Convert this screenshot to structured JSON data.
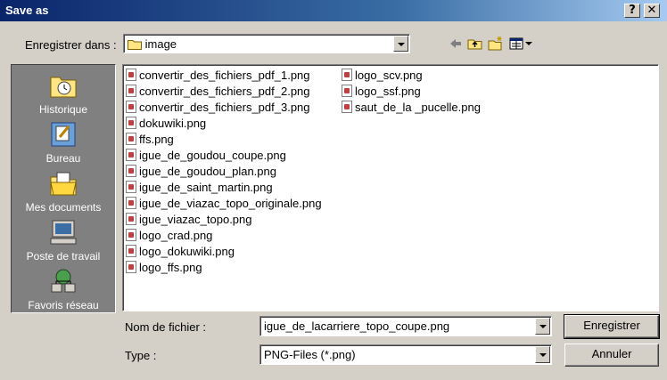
{
  "window": {
    "title": "Save as",
    "help_label": "?",
    "close_label": "✕"
  },
  "location": {
    "label": "Enregistrer dans :",
    "value": "image"
  },
  "places": [
    {
      "label": "Historique"
    },
    {
      "label": "Bureau"
    },
    {
      "label": "Mes documents"
    },
    {
      "label": "Poste de travail"
    },
    {
      "label": "Favoris réseau"
    }
  ],
  "files_col1": [
    "convertir_des_fichiers_pdf_1.png",
    "convertir_des_fichiers_pdf_2.png",
    "convertir_des_fichiers_pdf_3.png",
    "dokuwiki.png",
    "ffs.png",
    "igue_de_goudou_coupe.png",
    "igue_de_goudou_plan.png",
    "igue_de_saint_martin.png",
    "igue_de_viazac_topo_originale.png",
    "igue_viazac_topo.png",
    "logo_crad.png",
    "logo_dokuwiki.png",
    "logo_ffs.png"
  ],
  "files_col2": [
    "logo_scv.png",
    "logo_ssf.png",
    "saut_de_la _pucelle.png"
  ],
  "filename": {
    "label": "Nom de fichier :",
    "value": "igue_de_lacarriere_topo_coupe.png"
  },
  "filetype": {
    "label": "Type :",
    "value": "PNG-Files (*.png)"
  },
  "buttons": {
    "save": "Enregistrer",
    "cancel": "Annuler"
  },
  "icons": [
    "back-arrow-icon",
    "up-folder-icon",
    "new-folder-icon",
    "view-menu-icon"
  ]
}
